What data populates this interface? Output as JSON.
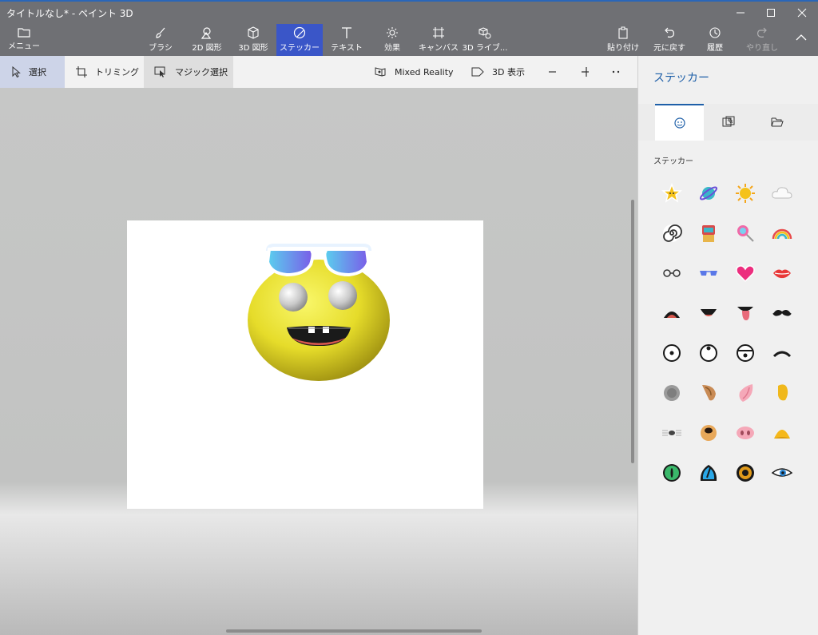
{
  "window": {
    "title": "タイトルなし* - ペイント 3D"
  },
  "toolbar": {
    "menu": "メニュー",
    "brush": "ブラシ",
    "shapes2d": "2D 図形",
    "shapes3d": "3D 図形",
    "stickers": "ステッカー",
    "text": "テキスト",
    "effects": "効果",
    "canvas": "キャンバス",
    "library3d": "3D ライブ...",
    "paste": "貼り付け",
    "undo": "元に戻す",
    "history": "履歴",
    "redo": "やり直し"
  },
  "subtoolbar": {
    "select": "選択",
    "crop": "トリミング",
    "magic_select": "マジック選択",
    "mixed_reality": "Mixed Reality",
    "view3d": "3D 表示"
  },
  "panel": {
    "title": "ステッカー",
    "section_label": "ステッカー",
    "tabs": [
      "sticker-tab",
      "texture-tab",
      "folder-tab"
    ],
    "stickers": [
      "star-sticker",
      "planet-sticker",
      "sun-sticker",
      "cloud-sticker",
      "spiral-sticker",
      "robot-sticker",
      "lollipop-sticker",
      "rainbow-sticker",
      "glasses-sticker",
      "sunglasses-sticker",
      "heart-sticker",
      "lips-sticker",
      "open-mouth-sticker",
      "smile-mouth-sticker",
      "tongue-mouth-sticker",
      "mustache-sticker",
      "eye-center-sticker",
      "eye-up-sticker",
      "eye-down-sticker",
      "closed-eye-sticker",
      "gray-ear-sticker",
      "dog-ear-sticker",
      "pink-ear-sticker",
      "yellow-ear-sticker",
      "whisker-nose-sticker",
      "dog-nose-sticker",
      "pig-nose-sticker",
      "beak-sticker",
      "green-eye-sticker",
      "cat-eye-sticker",
      "brown-eye-sticker",
      "lash-eye-sticker"
    ]
  },
  "colors": {
    "accent": "#3a56c8",
    "chrome": "#6f7074",
    "panel_title": "#1e5fa8"
  }
}
